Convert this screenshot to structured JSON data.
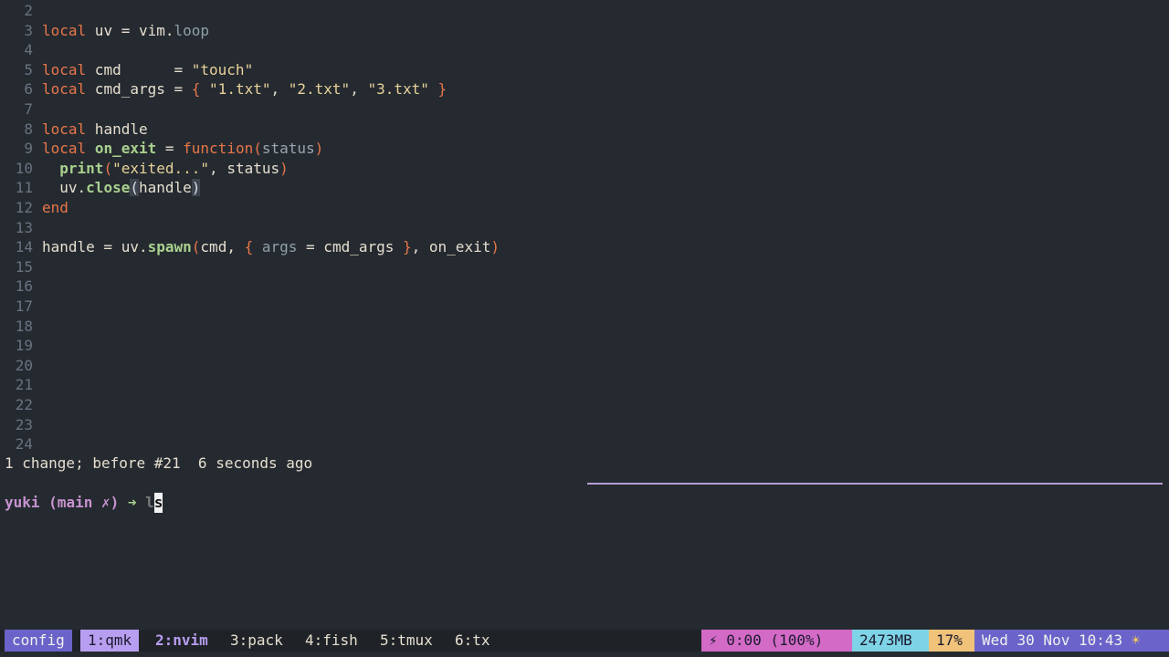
{
  "editor": {
    "lines": [
      {
        "num": "2",
        "tokens": []
      },
      {
        "num": "3",
        "tokens": [
          {
            "t": "local",
            "c": "keyword"
          },
          {
            "t": " uv = vim",
            "c": "ident"
          },
          {
            "t": ".",
            "c": "op"
          },
          {
            "t": "loop",
            "c": "field"
          }
        ]
      },
      {
        "num": "4",
        "tokens": []
      },
      {
        "num": "5",
        "tokens": [
          {
            "t": "local",
            "c": "keyword"
          },
          {
            "t": " cmd      = ",
            "c": "ident"
          },
          {
            "t": "\"touch\"",
            "c": "string"
          }
        ]
      },
      {
        "num": "6",
        "tokens": [
          {
            "t": "local",
            "c": "keyword"
          },
          {
            "t": " cmd_args = ",
            "c": "ident"
          },
          {
            "t": "{",
            "c": "brace"
          },
          {
            "t": " ",
            "c": "ident"
          },
          {
            "t": "\"1.txt\"",
            "c": "string"
          },
          {
            "t": ", ",
            "c": "ident"
          },
          {
            "t": "\"2.txt\"",
            "c": "string"
          },
          {
            "t": ", ",
            "c": "ident"
          },
          {
            "t": "\"3.txt\"",
            "c": "string"
          },
          {
            "t": " ",
            "c": "ident"
          },
          {
            "t": "}",
            "c": "brace"
          }
        ]
      },
      {
        "num": "7",
        "tokens": []
      },
      {
        "num": "8",
        "tokens": [
          {
            "t": "local",
            "c": "keyword"
          },
          {
            "t": " handle",
            "c": "ident"
          }
        ]
      },
      {
        "num": "9",
        "tokens": [
          {
            "t": "local",
            "c": "keyword"
          },
          {
            "t": " ",
            "c": "ident"
          },
          {
            "t": "on_exit",
            "c": "fn"
          },
          {
            "t": " = ",
            "c": "ident"
          },
          {
            "t": "function",
            "c": "keyword"
          },
          {
            "t": "(",
            "c": "brace"
          },
          {
            "t": "status",
            "c": "param"
          },
          {
            "t": ")",
            "c": "brace"
          }
        ]
      },
      {
        "num": "10",
        "tokens": [
          {
            "t": "  ",
            "c": "ident"
          },
          {
            "t": "print",
            "c": "fn"
          },
          {
            "t": "(",
            "c": "brace"
          },
          {
            "t": "\"exited...\"",
            "c": "string"
          },
          {
            "t": ", status",
            "c": "ident"
          },
          {
            "t": ")",
            "c": "brace"
          }
        ]
      },
      {
        "num": "11",
        "tokens": [
          {
            "t": "  uv",
            "c": "ident"
          },
          {
            "t": ".",
            "c": "op"
          },
          {
            "t": "close",
            "c": "fn"
          },
          {
            "t": "(",
            "c": "highlight"
          },
          {
            "t": "handle",
            "c": "ident"
          },
          {
            "t": ")",
            "c": "highlight"
          }
        ]
      },
      {
        "num": "12",
        "tokens": [
          {
            "t": "end",
            "c": "keyword"
          }
        ]
      },
      {
        "num": "13",
        "tokens": []
      },
      {
        "num": "14",
        "tokens": [
          {
            "t": "handle = uv",
            "c": "ident"
          },
          {
            "t": ".",
            "c": "op"
          },
          {
            "t": "spawn",
            "c": "fn"
          },
          {
            "t": "(",
            "c": "brace"
          },
          {
            "t": "cmd, ",
            "c": "ident"
          },
          {
            "t": "{",
            "c": "brace"
          },
          {
            "t": " ",
            "c": "ident"
          },
          {
            "t": "args",
            "c": "field"
          },
          {
            "t": " = cmd_args ",
            "c": "ident"
          },
          {
            "t": "}",
            "c": "brace"
          },
          {
            "t": ", on_exit",
            "c": "ident"
          },
          {
            "t": ")",
            "c": "brace"
          }
        ]
      },
      {
        "num": "15",
        "tokens": []
      },
      {
        "num": "16",
        "tokens": []
      },
      {
        "num": "17",
        "tokens": []
      },
      {
        "num": "18",
        "tokens": []
      },
      {
        "num": "19",
        "tokens": []
      },
      {
        "num": "20",
        "tokens": []
      },
      {
        "num": "21",
        "tokens": []
      },
      {
        "num": "22",
        "tokens": []
      },
      {
        "num": "23",
        "tokens": []
      },
      {
        "num": "24",
        "tokens": []
      }
    ],
    "status_message": "1 change; before #21  6 seconds ago"
  },
  "shell": {
    "user": "yuki",
    "branch": "(main ✗)",
    "arrow": "➜",
    "input": "l",
    "cursor_char": "s"
  },
  "tmux": {
    "session": "config",
    "windows": [
      "1:qmk",
      "2:nvim",
      "3:pack",
      "4:fish",
      "5:tmux",
      "6:tx"
    ],
    "battery": "⚡ 0:00 (100%)",
    "memory": "2473MB",
    "cpu": "17%",
    "clock": "Wed 30 Nov 10:43",
    "weather_icon": "☀"
  },
  "colors": {
    "background": "#252a30",
    "keyword": "#e8764a",
    "string": "#e8d29a",
    "function": "#a9d18e",
    "prompt_accent": "#c792cf",
    "tmux_session": "#6b63c9",
    "tmux_active_window": "#b89ef0"
  }
}
